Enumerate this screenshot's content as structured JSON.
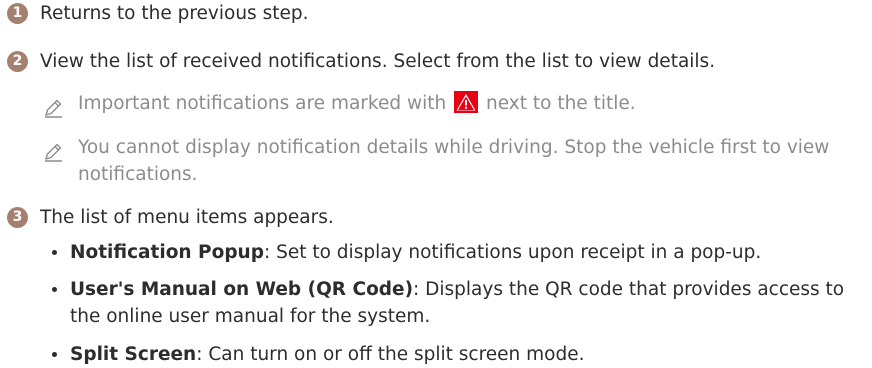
{
  "steps": [
    {
      "number": "1",
      "text": "Returns to the previous step."
    },
    {
      "number": "2",
      "text": "View the list of received notifications. Select from the list to view details."
    },
    {
      "number": "3",
      "text": "The list of menu items appears."
    }
  ],
  "notes": [
    {
      "before": "Important notifications are marked with",
      "after": "next to the title."
    },
    {
      "text": "You cannot display notification details while driving. Stop the vehicle first to view notifications."
    }
  ],
  "menu_items": [
    {
      "term": "Notification Popup",
      "desc": ": Set to display notifications upon receipt in a pop-up."
    },
    {
      "term": "User's Manual on Web (QR Code)",
      "desc": ": Displays the QR code that provides access to the online user manual for the system."
    },
    {
      "term": "Split Screen",
      "desc": ": Can turn on or off the split screen mode."
    }
  ],
  "colors": {
    "number_badge": "#a5806e",
    "note_text": "#8c8c8c",
    "warning_icon": "#e60012"
  },
  "icons": {
    "note": "pencil-icon",
    "important": "warning-triangle-icon"
  }
}
